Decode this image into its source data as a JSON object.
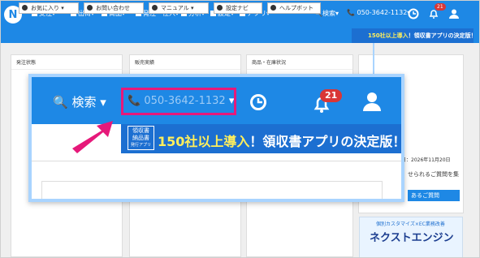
{
  "topnav": {
    "items": [
      "受注",
      "出荷",
      "商品",
      "発注・仕入",
      "分析",
      "設定",
      "アプリ"
    ],
    "search": "検索",
    "phone": "050-3642-1132",
    "badge": "21"
  },
  "subbar": {
    "buttons": [
      "お気に入り",
      "お問い合わせ",
      "マニュアル",
      "設定ナビ",
      "ヘルプボット"
    ],
    "banner_num": "150社以上導入",
    "banner_text": "領収書アプリの決定版！"
  },
  "panels": {
    "titles": [
      "発注状態",
      "販売実績",
      "商品・在庫状況"
    ]
  },
  "sidebar": {
    "question": "せられるご質問を集",
    "button": "あるご質問",
    "date": "日：2026年11月20日",
    "ad_sub": "個別カスタマイズ×EC業務改善",
    "ad_title": "ネクストエンジン"
  },
  "zoom": {
    "search": "検索",
    "phone": "050-3642-1132",
    "badge": "21",
    "logo_lines": [
      "領収書",
      "納品書",
      "発行アプリ"
    ],
    "banner_num": "150社以上導入",
    "banner_text": "領収書アプリの決定版！"
  },
  "colors": {
    "nav": "#1e88e5",
    "highlight": "#e6197a",
    "banner_yellow": "#ffef5c",
    "badge": "#d93636"
  }
}
